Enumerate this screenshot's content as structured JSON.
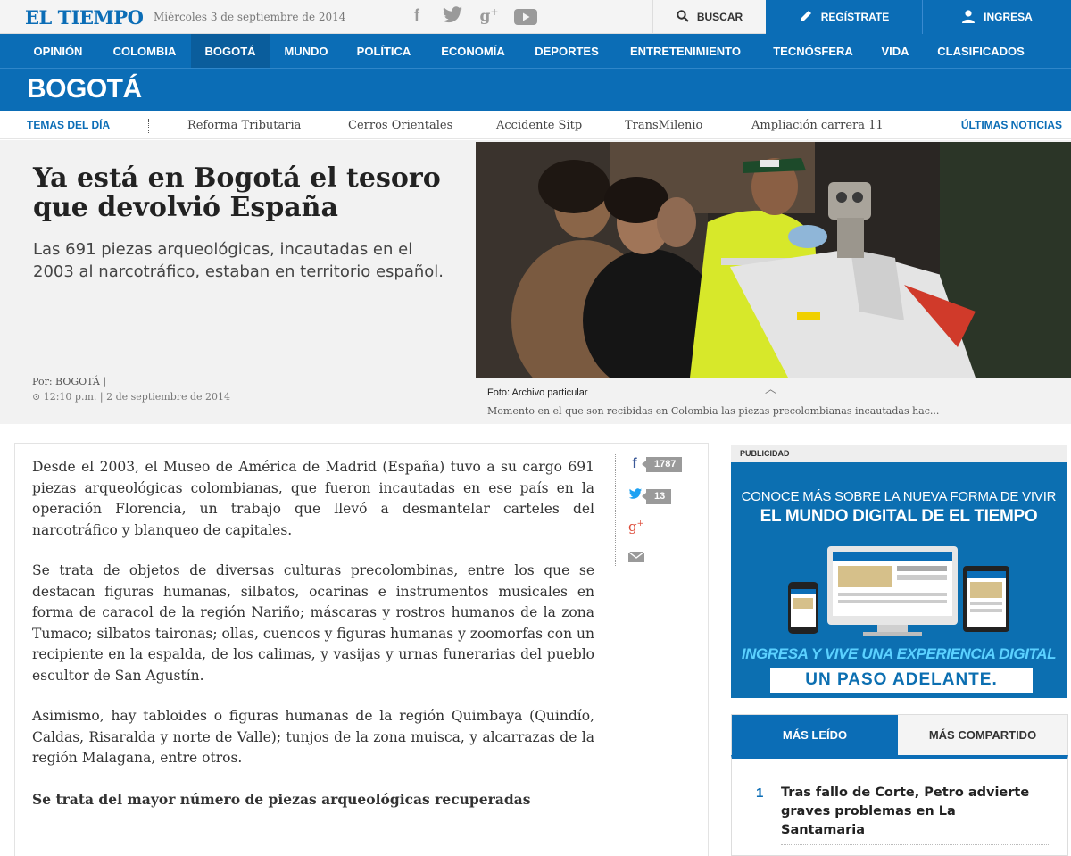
{
  "header": {
    "logo": "EL TIEMPO",
    "date": "Miércoles 3 de septiembre de 2014",
    "social": {
      "facebook": "f",
      "twitter": "🐦",
      "googleplus": "g+",
      "youtube": "▶"
    },
    "search_label": "BUSCAR",
    "register_label": "REGÍSTRATE",
    "login_label": "INGRESA"
  },
  "nav": {
    "items": [
      "OPINIÓN",
      "COLOMBIA",
      "BOGOTÁ",
      "MUNDO",
      "POLÍTICA",
      "ECONOMÍA",
      "DEPORTES",
      "ENTRETENIMIENTO",
      "TECNÓSFERA",
      "VIDA",
      "CLASIFICADOS"
    ],
    "active": "BOGOTÁ"
  },
  "section": {
    "title": "BOGOTÁ"
  },
  "temas": {
    "label": "TEMAS DEL DÍA",
    "items": [
      "Reforma Tributaria",
      "Cerros Orientales",
      "Accidente Sitp",
      "TransMilenio",
      "Ampliación carrera 11"
    ],
    "latest_label": "ÚLTIMAS NOTICIAS"
  },
  "hero": {
    "headline": "Ya está en Bogotá el tesoro que devolvió España",
    "subhead": "Las 691 piezas arqueológicas, incautadas en el 2003 al narcotráfico, estaban en territorio español.",
    "byline": "Por: BOGOTÁ |",
    "time": "12:10 p.m. | 2 de septiembre de 2014",
    "photo_credit": "Foto: Archivo particular",
    "photo_caption": "Momento en el que son recibidas en Colombia las piezas precolombianas incautadas hac..."
  },
  "article": {
    "paragraphs": [
      "Desde el 2003, el Museo de América de Madrid (España) tuvo a su cargo 691 piezas arqueológicas colombianas, que fueron incautadas en ese país en la operación Florencia, un trabajo que llevó a desmantelar carteles del narcotráfico y blanqueo de capitales.",
      "Se trata de objetos de diversas culturas precolombinas, entre los que se destacan figuras humanas, silbatos, ocarinas e instrumentos musicales en forma de caracol de la región Nariño; máscaras y rostros humanos de la zona Tumaco; silbatos taironas; ollas, cuencos y figuras humanas y zoomorfas con un recipiente en la espalda, de los calimas, y vasijas y urnas funerarias del pueblo escultor de San Agustín.",
      "Asimismo, hay tabloides o figuras humanas de la región Quimbaya (Quindío, Caldas, Risaralda y norte de Valle); tunjos de la zona muisca, y alcarrazas de la región Malagana, entre otros.",
      "Se trata del mayor número de piezas arqueológicas recuperadas"
    ],
    "share": {
      "facebook_count": "1787",
      "twitter_count": "13"
    }
  },
  "ad": {
    "label": "PUBLICIDAD",
    "line1": "CONOCE MÁS SOBRE LA NUEVA FORMA DE VIVIR",
    "line2": "EL MUNDO DIGITAL DE EL TIEMPO",
    "line3": "INGRESA Y VIVE UNA EXPERIENCIA DIGITAL",
    "line4": "UN PASO ADELANTE."
  },
  "most": {
    "tab_read": "MÁS LEÍDO",
    "tab_shared": "MÁS COMPARTIDO",
    "items": [
      {
        "rank": "1",
        "title": "Tras fallo de Corte, Petro advierte graves problemas en La Santamaria"
      }
    ]
  }
}
